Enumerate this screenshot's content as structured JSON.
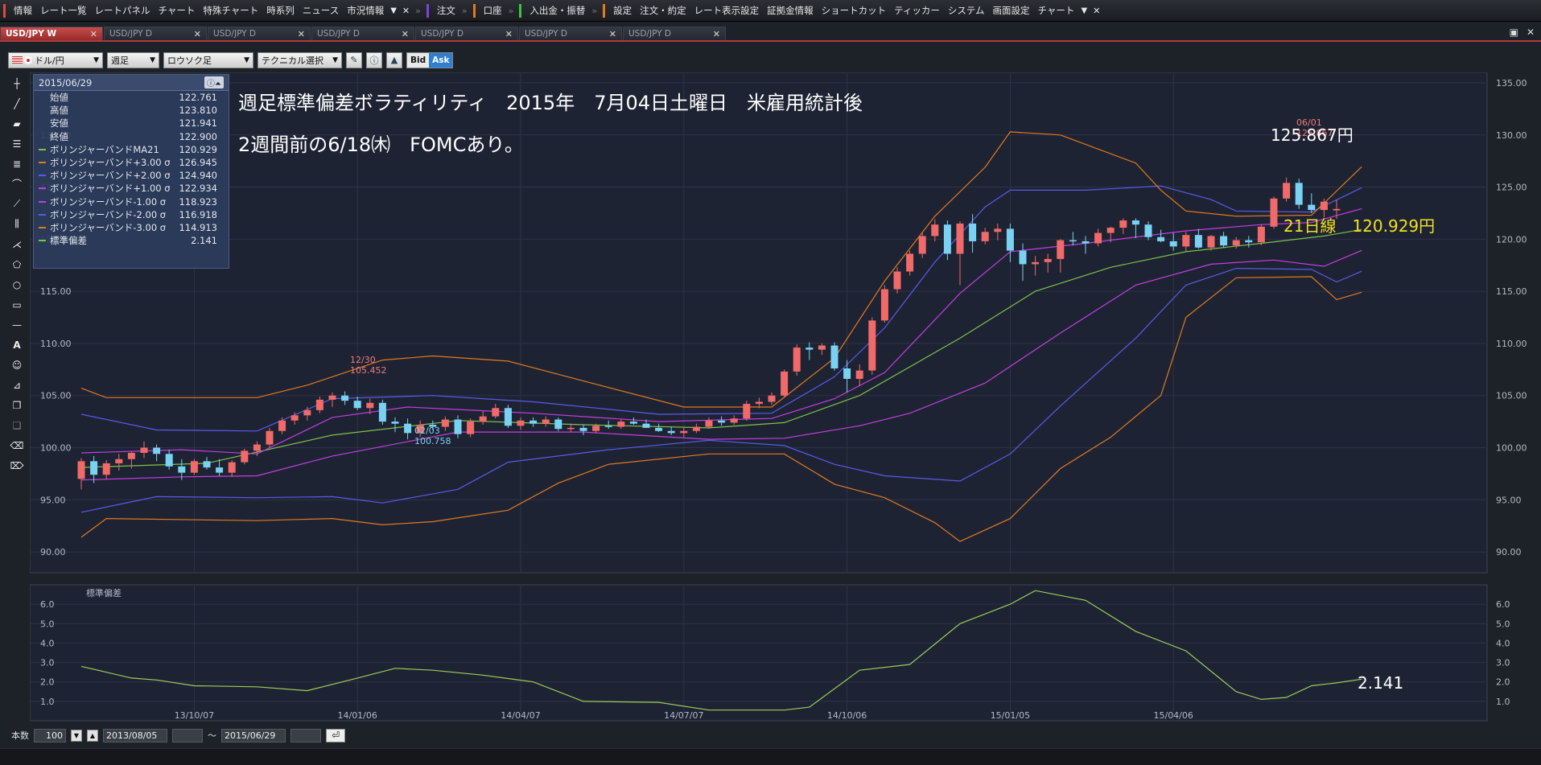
{
  "menu": {
    "groups": [
      {
        "color": "#e04a3a",
        "items": [
          "情報",
          "レート一覧",
          "レートパネル",
          "チャート",
          "特殊チャート",
          "時系列",
          "ニュース",
          "市況情報"
        ]
      },
      {
        "color": "#7a46d8",
        "items": [
          "注文"
        ]
      },
      {
        "color": "#e07a20",
        "items": [
          "口座"
        ]
      },
      {
        "color": "#3ec43e",
        "items": [
          "入出金・振替"
        ]
      },
      {
        "color": "#e07a20",
        "items": [
          "設定",
          "注文・約定",
          "レート表示設定",
          "証拠金情報",
          "ショートカット",
          "ティッカー",
          "システム",
          "画面設定",
          "チャート"
        ]
      }
    ]
  },
  "tabs": [
    {
      "label": "USD/JPY W",
      "active": true
    },
    {
      "label": "USD/JPY D",
      "active": false
    },
    {
      "label": "USD/JPY D",
      "active": false
    },
    {
      "label": "USD/JPY D",
      "active": false
    },
    {
      "label": "USD/JPY D",
      "active": false
    },
    {
      "label": "USD/JPY D",
      "active": false
    },
    {
      "label": "USD/JPY D",
      "active": false
    }
  ],
  "toolbar": {
    "currency": "ドル/円",
    "period": "週足",
    "chart_kind": "ロウソク足",
    "technical": "テクニカル選択",
    "bid": "Bid",
    "ask": "Ask"
  },
  "info": {
    "date": "2015/06/29",
    "rows": [
      {
        "label": "始値",
        "value": "122.761",
        "color": ""
      },
      {
        "label": "高値",
        "value": "123.810",
        "color": ""
      },
      {
        "label": "安値",
        "value": "121.941",
        "color": ""
      },
      {
        "label": "終値",
        "value": "122.900",
        "color": ""
      },
      {
        "label": "ボリンジャーバンドMA21",
        "value": "120.929",
        "color": "#7cc24a"
      },
      {
        "label": "ボリンジャーバンド+3.00 σ",
        "value": "126.945",
        "color": "#e07a20"
      },
      {
        "label": "ボリンジャーバンド+2.00 σ",
        "value": "124.940",
        "color": "#5a5ae8"
      },
      {
        "label": "ボリンジャーバンド+1.00 σ",
        "value": "122.934",
        "color": "#c040e0"
      },
      {
        "label": "ボリンジャーバンド-1.00 σ",
        "value": "118.923",
        "color": "#c040e0"
      },
      {
        "label": "ボリンジャーバンド-2.00 σ",
        "value": "116.918",
        "color": "#5a5ae8"
      },
      {
        "label": "ボリンジャーバンド-3.00 σ",
        "value": "114.913",
        "color": "#e07a20"
      },
      {
        "label": "標準偏差",
        "value": "2.141",
        "color": "#7cc24a"
      }
    ]
  },
  "annotations": {
    "line1": "週足標準偏差ボラティリティ　2015年　7月04日土曜日　米雇用統計後",
    "line2": "2週間前の6/18㈭　FOMCあり。",
    "high_price": "125.867円",
    "ma_label": "21日線　120.929円",
    "stddev_value": "2.141",
    "peak_date": "06/01",
    "peak_value": "125.867",
    "dec_date": "12/30",
    "dec_value": "105.452",
    "feb_date": "02/03",
    "feb_value": "100.758"
  },
  "chart_data": {
    "type": "candlestick",
    "main_y_ticks": [
      90,
      95,
      100,
      105,
      110,
      115,
      120,
      125,
      130,
      135
    ],
    "main_y_labels": [
      "90.00",
      "95.00",
      "100.00",
      "105.00",
      "110.00",
      "115.00",
      "120.00",
      "125.00",
      "130.00",
      "135.00"
    ],
    "sub_title": "標準偏差",
    "sub_y_ticks": [
      1,
      2,
      3,
      4,
      5,
      6
    ],
    "sub_y_labels": [
      "1.0",
      "2.0",
      "3.0",
      "4.0",
      "5.0",
      "6.0"
    ],
    "x_labels": [
      "13/10/07",
      "14/01/06",
      "14/04/07",
      "14/07/07",
      "14/10/06",
      "15/01/05",
      "15/04/06"
    ],
    "x_label_index": [
      9,
      22,
      35,
      48,
      61,
      74,
      87
    ],
    "candles": [
      [
        97.0,
        99.0,
        96.0,
        98.7
      ],
      [
        98.7,
        99.2,
        96.6,
        97.4
      ],
      [
        97.4,
        98.8,
        97.0,
        98.5
      ],
      [
        98.5,
        99.4,
        97.8,
        98.9
      ],
      [
        98.9,
        99.6,
        98.0,
        99.5
      ],
      [
        99.5,
        100.6,
        99.0,
        100.0
      ],
      [
        100.0,
        100.3,
        98.7,
        99.4
      ],
      [
        99.4,
        99.8,
        97.9,
        98.2
      ],
      [
        98.2,
        98.9,
        96.9,
        97.6
      ],
      [
        97.6,
        98.9,
        97.4,
        98.7
      ],
      [
        98.7,
        99.1,
        97.9,
        98.1
      ],
      [
        98.1,
        98.9,
        97.3,
        97.6
      ],
      [
        97.6,
        98.8,
        97.2,
        98.6
      ],
      [
        98.6,
        99.9,
        98.4,
        99.7
      ],
      [
        99.7,
        100.6,
        99.2,
        100.3
      ],
      [
        100.3,
        101.9,
        100.0,
        101.6
      ],
      [
        101.6,
        102.9,
        101.3,
        102.6
      ],
      [
        102.6,
        103.4,
        102.2,
        103.1
      ],
      [
        103.1,
        103.9,
        102.6,
        103.6
      ],
      [
        103.6,
        104.9,
        103.3,
        104.6
      ],
      [
        104.6,
        105.3,
        103.9,
        105.0
      ],
      [
        105.0,
        105.4,
        104.1,
        104.5
      ],
      [
        104.5,
        104.9,
        103.6,
        103.8
      ],
      [
        103.8,
        104.7,
        103.2,
        104.3
      ],
      [
        104.3,
        104.6,
        102.2,
        102.5
      ],
      [
        102.5,
        102.9,
        101.5,
        102.3
      ],
      [
        102.3,
        102.8,
        100.8,
        101.4
      ],
      [
        101.4,
        102.6,
        101.0,
        102.2
      ],
      [
        102.2,
        102.6,
        101.7,
        102.0
      ],
      [
        102.0,
        103.0,
        101.6,
        102.7
      ],
      [
        102.7,
        103.1,
        100.9,
        101.3
      ],
      [
        101.3,
        102.8,
        101.0,
        102.5
      ],
      [
        102.5,
        103.5,
        102.2,
        103.0
      ],
      [
        103.0,
        104.2,
        102.8,
        103.8
      ],
      [
        103.8,
        104.1,
        101.9,
        102.1
      ],
      [
        102.1,
        102.9,
        101.7,
        102.6
      ],
      [
        102.6,
        102.9,
        102.0,
        102.3
      ],
      [
        102.3,
        103.0,
        102.0,
        102.7
      ],
      [
        102.7,
        102.9,
        101.6,
        101.8
      ],
      [
        101.8,
        102.3,
        101.5,
        101.9
      ],
      [
        101.9,
        102.2,
        101.2,
        101.6
      ],
      [
        101.6,
        102.3,
        101.4,
        102.1
      ],
      [
        102.1,
        102.6,
        101.8,
        102.0
      ],
      [
        102.0,
        102.7,
        101.8,
        102.5
      ],
      [
        102.5,
        102.9,
        102.2,
        102.3
      ],
      [
        102.3,
        102.7,
        101.9,
        101.9
      ],
      [
        101.9,
        102.3,
        101.5,
        101.6
      ],
      [
        101.6,
        102.0,
        101.2,
        101.4
      ],
      [
        101.4,
        101.9,
        101.0,
        101.6
      ],
      [
        101.6,
        102.3,
        101.4,
        102.0
      ],
      [
        102.0,
        102.9,
        101.8,
        102.6
      ],
      [
        102.6,
        103.0,
        102.1,
        102.4
      ],
      [
        102.4,
        103.1,
        102.2,
        102.8
      ],
      [
        102.8,
        104.5,
        102.6,
        104.2
      ],
      [
        104.2,
        104.8,
        103.8,
        104.4
      ],
      [
        104.4,
        105.3,
        104.1,
        105.0
      ],
      [
        105.0,
        107.5,
        104.8,
        107.3
      ],
      [
        107.3,
        109.9,
        106.9,
        109.6
      ],
      [
        109.6,
        110.1,
        108.4,
        109.4
      ],
      [
        109.4,
        110.0,
        108.9,
        109.8
      ],
      [
        109.8,
        110.1,
        107.4,
        107.6
      ],
      [
        107.6,
        108.4,
        105.3,
        106.6
      ],
      [
        106.6,
        108.0,
        105.9,
        107.4
      ],
      [
        107.4,
        112.5,
        107.0,
        112.2
      ],
      [
        112.2,
        115.6,
        112.0,
        115.2
      ],
      [
        115.2,
        117.3,
        114.8,
        116.9
      ],
      [
        116.9,
        118.9,
        116.5,
        118.6
      ],
      [
        118.6,
        120.7,
        118.2,
        120.3
      ],
      [
        120.3,
        121.9,
        119.8,
        121.4
      ],
      [
        121.4,
        121.8,
        118.0,
        118.6
      ],
      [
        118.6,
        121.7,
        115.6,
        121.5
      ],
      [
        121.5,
        122.4,
        118.7,
        119.8
      ],
      [
        119.8,
        121.1,
        119.5,
        120.7
      ],
      [
        120.7,
        121.5,
        119.9,
        121.0
      ],
      [
        121.0,
        121.5,
        117.8,
        118.9
      ],
      [
        118.9,
        119.6,
        116.0,
        117.6
      ],
      [
        117.6,
        118.4,
        116.5,
        117.8
      ],
      [
        117.8,
        118.6,
        116.8,
        118.1
      ],
      [
        118.1,
        120.0,
        116.8,
        119.9
      ],
      [
        119.9,
        120.7,
        119.4,
        119.8
      ],
      [
        119.8,
        120.3,
        118.6,
        119.6
      ],
      [
        119.6,
        121.0,
        119.3,
        120.6
      ],
      [
        120.6,
        121.2,
        119.7,
        121.1
      ],
      [
        121.1,
        122.0,
        120.5,
        121.8
      ],
      [
        121.8,
        122.0,
        120.1,
        121.4
      ],
      [
        121.4,
        121.7,
        119.9,
        120.2
      ],
      [
        120.2,
        120.9,
        119.7,
        119.8
      ],
      [
        119.8,
        120.6,
        118.9,
        119.3
      ],
      [
        119.3,
        120.7,
        118.8,
        120.4
      ],
      [
        120.4,
        121.0,
        119.1,
        119.2
      ],
      [
        119.2,
        120.4,
        118.9,
        120.3
      ],
      [
        120.3,
        120.7,
        119.2,
        119.4
      ],
      [
        119.4,
        120.2,
        119.1,
        119.9
      ],
      [
        119.9,
        120.3,
        119.2,
        119.7
      ],
      [
        119.7,
        121.4,
        119.4,
        121.2
      ],
      [
        121.2,
        124.1,
        121.0,
        123.9
      ],
      [
        123.9,
        125.9,
        123.6,
        125.4
      ],
      [
        125.4,
        125.8,
        122.9,
        123.3
      ],
      [
        123.3,
        124.4,
        122.5,
        122.8
      ],
      [
        122.8,
        123.9,
        122.1,
        123.6
      ],
      [
        122.761,
        123.81,
        121.941,
        122.9
      ]
    ],
    "bands": {
      "ma": [
        [
          0,
          98.1
        ],
        [
          10,
          98.5
        ],
        [
          20,
          101.2
        ],
        [
          30,
          102.6
        ],
        [
          40,
          102.2
        ],
        [
          50,
          101.9
        ],
        [
          56,
          102.4
        ],
        [
          62,
          105.0
        ],
        [
          70,
          110.5
        ],
        [
          76,
          115.0
        ],
        [
          82,
          117.3
        ],
        [
          88,
          118.8
        ],
        [
          94,
          119.6
        ],
        [
          99,
          120.3
        ],
        [
          102,
          120.93
        ]
      ],
      "p1": [
        [
          0,
          99.5
        ],
        [
          8,
          99.8
        ],
        [
          14,
          99.4
        ],
        [
          20,
          102.9
        ],
        [
          26,
          103.9
        ],
        [
          36,
          103.3
        ],
        [
          46,
          102.5
        ],
        [
          55,
          102.8
        ],
        [
          60,
          104.7
        ],
        [
          64,
          107.2
        ],
        [
          70,
          114.8
        ],
        [
          74,
          118.8
        ],
        [
          80,
          119.6
        ],
        [
          88,
          120.8
        ],
        [
          94,
          121.4
        ],
        [
          98,
          121.6
        ],
        [
          102,
          122.93
        ]
      ],
      "m1": [
        [
          0,
          96.9
        ],
        [
          8,
          97.2
        ],
        [
          14,
          97.3
        ],
        [
          20,
          99.2
        ],
        [
          30,
          101.5
        ],
        [
          40,
          101.5
        ],
        [
          50,
          100.8
        ],
        [
          56,
          100.9
        ],
        [
          62,
          102.1
        ],
        [
          66,
          103.3
        ],
        [
          72,
          106.2
        ],
        [
          78,
          111.0
        ],
        [
          84,
          115.6
        ],
        [
          90,
          117.6
        ],
        [
          95,
          118.0
        ],
        [
          99,
          117.4
        ],
        [
          102,
          118.92
        ]
      ],
      "p2": [
        [
          0,
          103.2
        ],
        [
          6,
          101.7
        ],
        [
          14,
          101.6
        ],
        [
          20,
          104.7
        ],
        [
          28,
          105.0
        ],
        [
          36,
          104.4
        ],
        [
          46,
          103.2
        ],
        [
          55,
          103.3
        ],
        [
          60,
          106.8
        ],
        [
          64,
          111.5
        ],
        [
          68,
          117.8
        ],
        [
          72,
          123.1
        ],
        [
          74,
          124.7
        ],
        [
          80,
          124.7
        ],
        [
          86,
          125.1
        ],
        [
          90,
          123.8
        ],
        [
          92,
          122.7
        ],
        [
          98,
          122.6
        ],
        [
          102,
          124.94
        ]
      ],
      "m2": [
        [
          0,
          93.8
        ],
        [
          6,
          95.3
        ],
        [
          14,
          95.2
        ],
        [
          20,
          95.3
        ],
        [
          24,
          94.7
        ],
        [
          30,
          96.0
        ],
        [
          34,
          98.6
        ],
        [
          42,
          99.8
        ],
        [
          50,
          100.7
        ],
        [
          56,
          100.2
        ],
        [
          60,
          98.4
        ],
        [
          64,
          97.3
        ],
        [
          70,
          96.8
        ],
        [
          74,
          99.4
        ],
        [
          78,
          104.0
        ],
        [
          84,
          110.5
        ],
        [
          88,
          115.6
        ],
        [
          92,
          117.2
        ],
        [
          98,
          117.1
        ],
        [
          100,
          115.9
        ],
        [
          102,
          116.92
        ]
      ],
      "p3": [
        [
          0,
          105.7
        ],
        [
          2,
          104.8
        ],
        [
          14,
          104.8
        ],
        [
          18,
          106.0
        ],
        [
          24,
          108.4
        ],
        [
          28,
          108.8
        ],
        [
          34,
          108.3
        ],
        [
          40,
          106.4
        ],
        [
          48,
          103.9
        ],
        [
          55,
          103.9
        ],
        [
          60,
          108.6
        ],
        [
          64,
          116.0
        ],
        [
          68,
          122.2
        ],
        [
          72,
          126.9
        ],
        [
          74,
          130.3
        ],
        [
          78,
          130.0
        ],
        [
          84,
          127.3
        ],
        [
          86,
          124.7
        ],
        [
          88,
          122.7
        ],
        [
          92,
          122.2
        ],
        [
          98,
          122.3
        ],
        [
          102,
          126.95
        ]
      ],
      "m3": [
        [
          0,
          91.4
        ],
        [
          2,
          93.2
        ],
        [
          14,
          93.0
        ],
        [
          20,
          93.2
        ],
        [
          24,
          92.6
        ],
        [
          28,
          92.9
        ],
        [
          34,
          94.0
        ],
        [
          38,
          96.6
        ],
        [
          42,
          98.4
        ],
        [
          50,
          99.4
        ],
        [
          56,
          99.4
        ],
        [
          60,
          96.5
        ],
        [
          64,
          95.2
        ],
        [
          68,
          92.8
        ],
        [
          70,
          91.0
        ],
        [
          74,
          93.2
        ],
        [
          78,
          98.0
        ],
        [
          82,
          101.0
        ],
        [
          86,
          105.0
        ],
        [
          88,
          112.5
        ],
        [
          92,
          116.3
        ],
        [
          98,
          116.4
        ],
        [
          100,
          114.2
        ],
        [
          102,
          114.91
        ]
      ]
    },
    "stddev": [
      [
        0,
        2.8
      ],
      [
        4,
        2.2
      ],
      [
        6,
        2.1
      ],
      [
        9,
        1.8
      ],
      [
        14,
        1.75
      ],
      [
        18,
        1.55
      ],
      [
        22,
        2.2
      ],
      [
        25,
        2.7
      ],
      [
        28,
        2.6
      ],
      [
        32,
        2.35
      ],
      [
        36,
        2.0
      ],
      [
        40,
        1.0
      ],
      [
        46,
        0.95
      ],
      [
        50,
        0.55
      ],
      [
        56,
        0.55
      ],
      [
        58,
        0.7
      ],
      [
        62,
        2.6
      ],
      [
        66,
        2.9
      ],
      [
        70,
        5.0
      ],
      [
        74,
        6.0
      ],
      [
        76,
        6.7
      ],
      [
        80,
        6.2
      ],
      [
        84,
        4.6
      ],
      [
        88,
        3.6
      ],
      [
        92,
        1.5
      ],
      [
        94,
        1.1
      ],
      [
        96,
        1.2
      ],
      [
        98,
        1.8
      ],
      [
        100,
        1.95
      ],
      [
        102,
        2.141
      ]
    ]
  }
}
